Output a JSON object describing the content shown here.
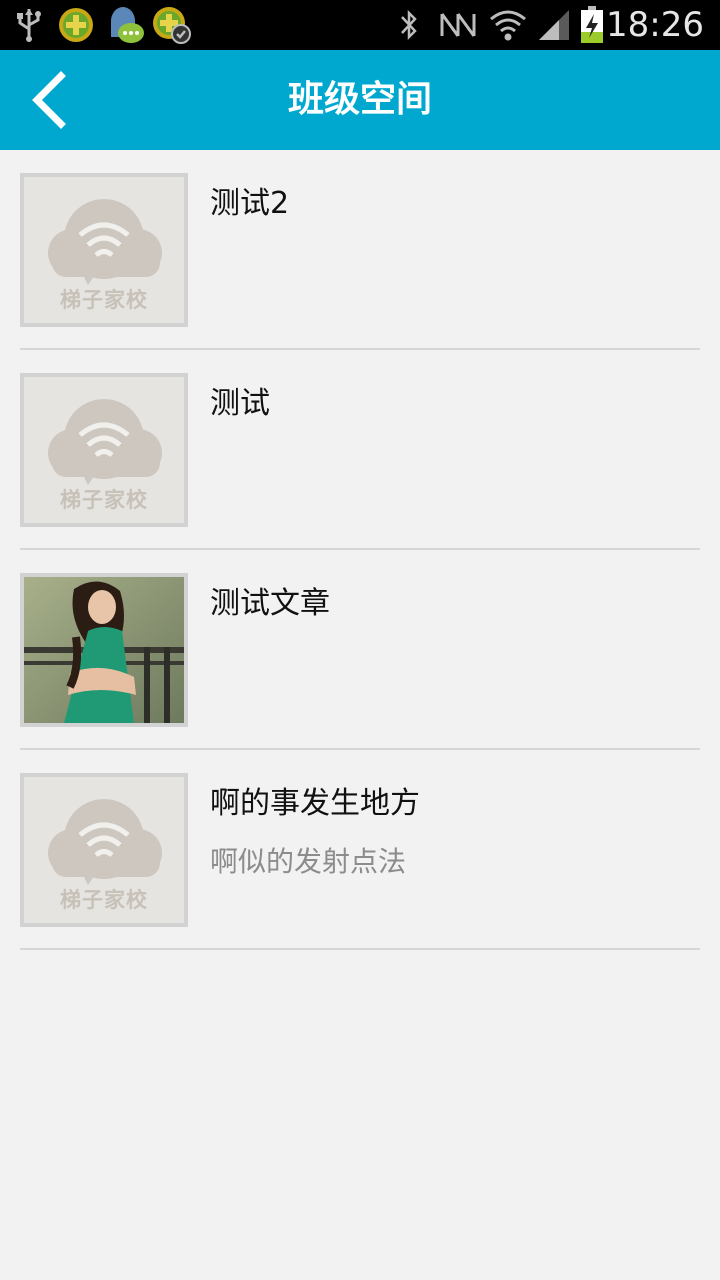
{
  "status_bar": {
    "time": "18:26",
    "icons": [
      "usb-icon",
      "app-plus-icon",
      "chat-notify-icon",
      "app-check-icon",
      "bluetooth-icon",
      "nfc-icon",
      "wifi-icon",
      "signal-icon",
      "battery-charging-icon"
    ],
    "colors": {
      "background": "#000000",
      "text": "#e6e6e6",
      "battery": "#9ccc2b"
    }
  },
  "header": {
    "title": "班级空间",
    "back_icon": "chevron-left-icon",
    "background": "#00a8d0"
  },
  "articles": [
    {
      "title": "测试2",
      "summary": "",
      "thumbnail": "placeholder",
      "placeholder_text": "梯子家校"
    },
    {
      "title": "测试",
      "summary": "",
      "thumbnail": "placeholder",
      "placeholder_text": "梯子家校"
    },
    {
      "title": "测试文章",
      "summary": "",
      "thumbnail": "photo-woman-green-dress"
    },
    {
      "title": "啊的事发生地方",
      "summary": "啊似的发射点法",
      "thumbnail": "placeholder",
      "placeholder_text": "梯子家校"
    }
  ]
}
